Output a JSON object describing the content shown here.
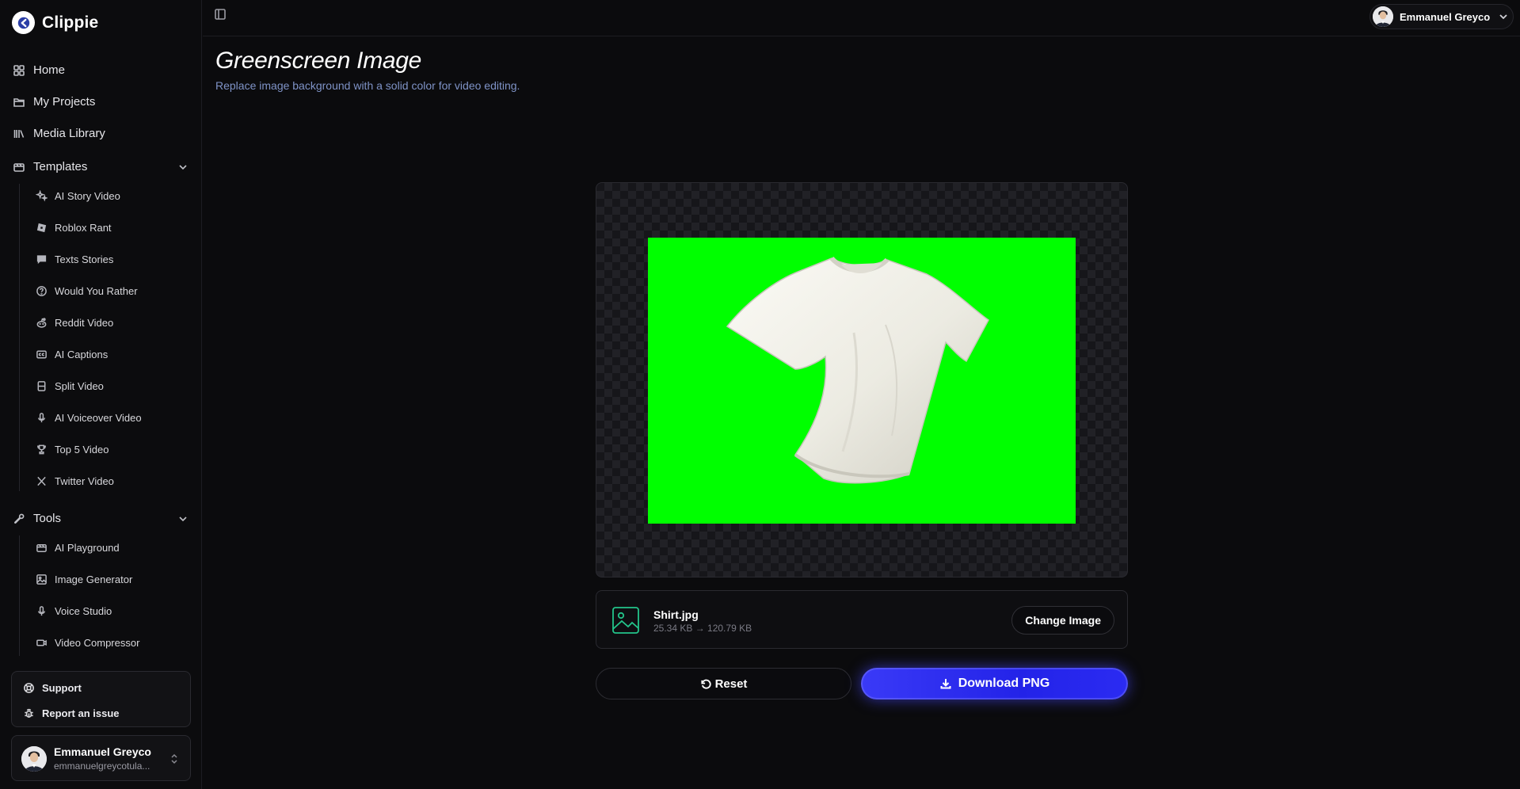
{
  "brand": {
    "name": "Clippie"
  },
  "nav": {
    "home": "Home",
    "projects": "My Projects",
    "media": "Media Library"
  },
  "templates": {
    "label": "Templates",
    "items": [
      {
        "label": "AI Story Video",
        "icon": "sparkles-icon"
      },
      {
        "label": "Roblox Rant",
        "icon": "roblox-icon"
      },
      {
        "label": "Texts Stories",
        "icon": "message-icon"
      },
      {
        "label": "Would You Rather",
        "icon": "question-icon"
      },
      {
        "label": "Reddit Video",
        "icon": "reddit-icon"
      },
      {
        "label": "AI Captions",
        "icon": "captions-icon"
      },
      {
        "label": "Split Video",
        "icon": "split-icon"
      },
      {
        "label": "AI Voiceover Video",
        "icon": "mic-icon"
      },
      {
        "label": "Top 5 Video",
        "icon": "trophy-icon"
      },
      {
        "label": "Twitter Video",
        "icon": "x-logo-icon"
      }
    ]
  },
  "tools": {
    "label": "Tools",
    "items": [
      {
        "label": "AI Playground",
        "icon": "playground-icon"
      },
      {
        "label": "Image Generator",
        "icon": "image-icon"
      },
      {
        "label": "Voice Studio",
        "icon": "mic-icon"
      },
      {
        "label": "Video Compressor",
        "icon": "video-icon"
      }
    ]
  },
  "support": {
    "support_label": "Support",
    "report_label": "Report an issue"
  },
  "user": {
    "name": "Emmanuel Greyco",
    "email": "emmanuelgreycotula..."
  },
  "main": {
    "title": "Greenscreen Image",
    "subtitle": "Replace image background with a solid color for video editing.",
    "background_color": "#00ff00",
    "file": {
      "name": "Shirt.jpg",
      "size": "25.34 KB → 120.79 KB"
    },
    "change_label": "Change Image",
    "reset_label": "Reset",
    "download_label": "Download PNG"
  },
  "colors": {
    "accent": "#2b2bf2",
    "file_icon": "#23c48a",
    "subtitle": "#7f93c7"
  }
}
